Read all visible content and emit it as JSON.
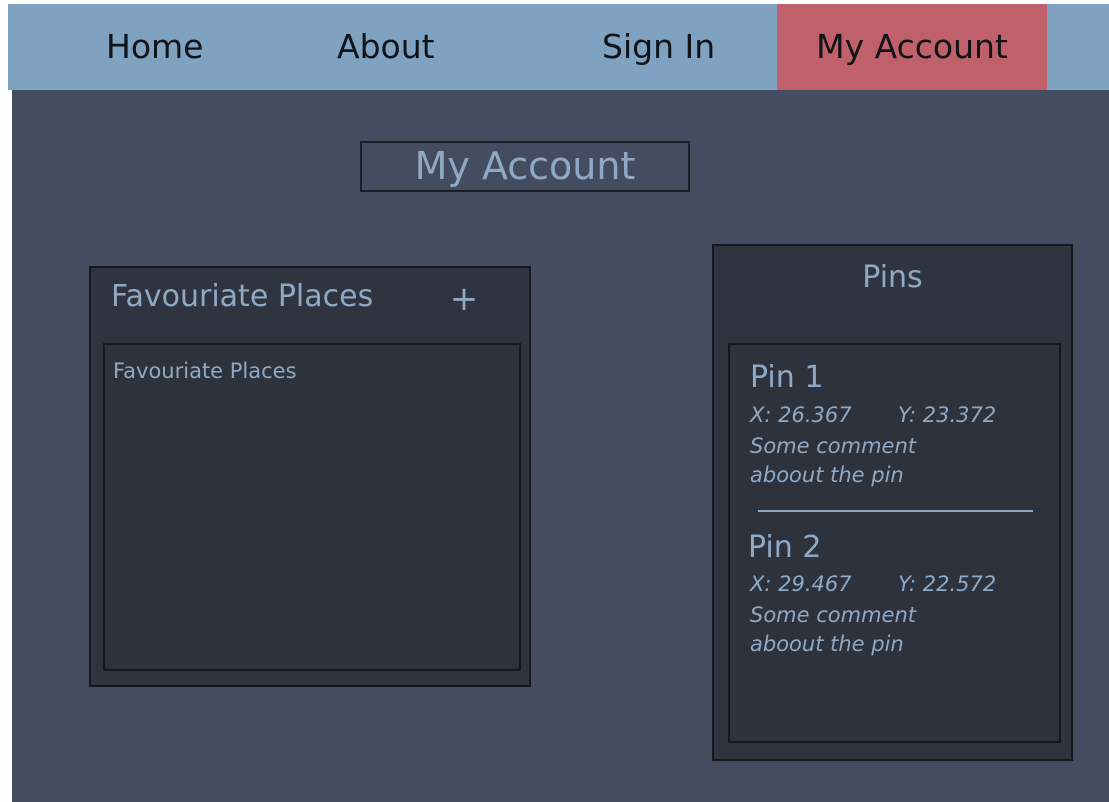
{
  "nav": {
    "home": "Home",
    "about": "About",
    "sign_in": "Sign In",
    "my_account": "My Account",
    "active_item": "My Account"
  },
  "page": {
    "title": "My Account"
  },
  "favourites": {
    "title": "Favouriate Places",
    "add_label": "+",
    "list_text": "Favouriate Places"
  },
  "pins": {
    "title": "Pins",
    "items": [
      {
        "name": "Pin 1",
        "x": "X: 26.367",
        "y": "Y: 23.372",
        "comment_line1": "Some comment",
        "comment_line2": "aboout the pin"
      },
      {
        "name": "Pin 2",
        "x": "X: 29.467",
        "y": "Y: 22.572",
        "comment_line1": "Some comment",
        "comment_line2": "aboout the pin"
      }
    ]
  },
  "colors": {
    "nav_background": "#7fa2c1",
    "active_nav": "#c0606a",
    "page_background": "#444c5f",
    "panel_background": "#2f3440",
    "text_accent": "#8fa9c4"
  }
}
